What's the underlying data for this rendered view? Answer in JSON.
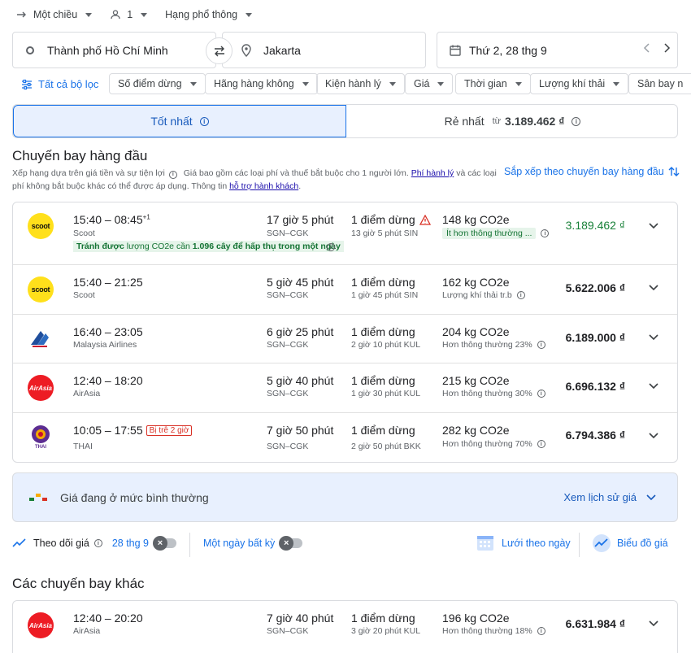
{
  "trip_options": {
    "trip_type": "Một chiều",
    "passengers": "1",
    "cabin_class": "Hạng phổ thông"
  },
  "search": {
    "origin": "Thành phố Hồ Chí Minh",
    "destination": "Jakarta",
    "date": "Thứ 2, 28 thg 9"
  },
  "filters": {
    "all_label": "Tất cả bộ lọc",
    "chips": [
      "Số điểm dừng",
      "Hãng hàng không",
      "Kiện hành lý",
      "Giá",
      "Thời gian",
      "Lượng khí thải",
      "Sân bay n"
    ]
  },
  "sort_tabs": {
    "best_label": "Tốt nhất",
    "cheapest_label": "Rẻ nhất",
    "cheapest_from": "từ",
    "cheapest_price": "3.189.462 ₫"
  },
  "top_flights": {
    "title": "Chuyến bay hàng đầu",
    "disclaimer_part1": "Xếp hạng dựa trên giá tiền và sự tiện lợi",
    "disclaimer_part2": "Giá bao gồm các loại phí và thuế bắt buộc cho 1 người lớn.",
    "baggage_fee_link": "Phí hành lý",
    "disclaimer_part3": "và các loại phí không bắt buộc khác có thể được áp dụng. Thông tin",
    "assistance_link": "hỗ trợ hành khách",
    "sort_label": "Sắp xếp theo chuyến bay hàng đầu",
    "flights": [
      {
        "times": "15:40 – 08:45",
        "next_day": "+1",
        "airline": "Scoot",
        "duration": "17 giờ 5 phút",
        "route": "SGN–CGK",
        "stops": "1 điểm dừng",
        "layover": "13 giờ 5 phút SIN",
        "co2": "148 kg CO2e",
        "co2_note": "Ít hơn thông thường ...",
        "price": "3.189.462 ₫",
        "avoid_text": "Tránh được",
        "avoid_mid": "lượng CO2e cần",
        "avoid_bold": "1.096 cây để hấp thụ trong một ngày"
      },
      {
        "times": "15:40 – 21:25",
        "airline": "Scoot",
        "duration": "5 giờ 45 phút",
        "route": "SGN–CGK",
        "stops": "1 điểm dừng",
        "layover": "1 giờ 45 phút SIN",
        "co2": "162 kg CO2e",
        "co2_note": "Lượng khí thải tr.b",
        "price": "5.622.006 ₫"
      },
      {
        "times": "16:40 – 23:05",
        "airline": "Malaysia Airlines",
        "duration": "6 giờ 25 phút",
        "route": "SGN–CGK",
        "stops": "1 điểm dừng",
        "layover": "2 giờ 10 phút KUL",
        "co2": "204 kg CO2e",
        "co2_note": "Hơn thông thường 23%",
        "price": "6.189.000 ₫"
      },
      {
        "times": "12:40 – 18:20",
        "airline": "AirAsia",
        "duration": "5 giờ 40 phút",
        "route": "SGN–CGK",
        "stops": "1 điểm dừng",
        "layover": "1 giờ 30 phút KUL",
        "co2": "215 kg CO2e",
        "co2_note": "Hơn thông thường 30%",
        "price": "6.696.132 ₫"
      },
      {
        "times": "10:05 – 17:55",
        "delay": "Bị trễ 2 giờ",
        "airline": "THAI",
        "duration": "7 giờ 50 phút",
        "route": "SGN–CGK",
        "stops": "1 điểm dừng",
        "layover": "2 giờ 50 phút BKK",
        "co2": "282 kg CO2e",
        "co2_note": "Hơn thông thường 70%",
        "price": "6.794.386 ₫"
      }
    ]
  },
  "price_insight": {
    "text_prefix": "Giá đang ở mức",
    "text_level": "bình thường",
    "history_link": "Xem lịch sử giá"
  },
  "tracking": {
    "track_label": "Theo dõi giá",
    "date_label": "28 thg 9",
    "any_date_label": "Một ngày bất kỳ",
    "grid_label": "Lưới theo ngày",
    "graph_label": "Biểu đồ giá"
  },
  "other_flights": {
    "title": "Các chuyến bay khác",
    "flights": [
      {
        "times": "12:40 – 20:20",
        "airline": "AirAsia",
        "duration": "7 giờ 40 phút",
        "route": "SGN–CGK",
        "stops": "1 điểm dừng",
        "layover": "3 giờ 20 phút KUL",
        "co2": "196 kg CO2e",
        "co2_note": "Hơn thông thường 18%",
        "price": "6.631.984 ₫"
      }
    ]
  },
  "colors": {
    "accent": "#1a73e8",
    "selected_tab_bg": "#e8f0fe",
    "cheap_price": "#188038",
    "warning": "#d93025"
  }
}
